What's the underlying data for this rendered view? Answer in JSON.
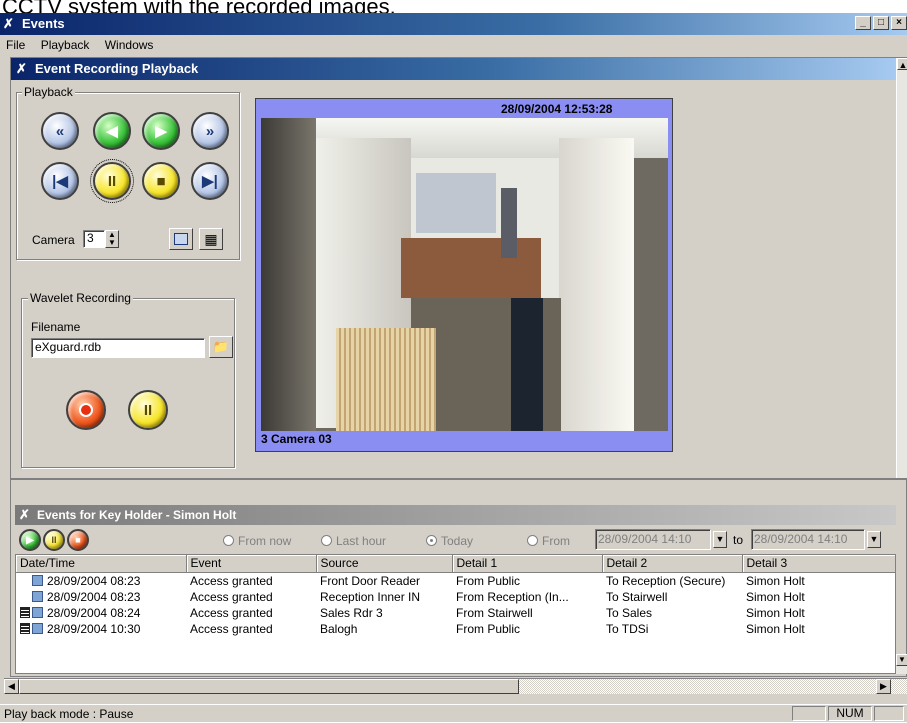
{
  "caption": "CCTV system with the recorded images.",
  "window": {
    "title": "Events",
    "btn_min": "_",
    "btn_max": "□",
    "btn_close": "×"
  },
  "menu": [
    "File",
    "Playback",
    "Windows"
  ],
  "playback_window": {
    "title": "Event Recording Playback"
  },
  "playback": {
    "group_label": "Playback",
    "camera_label": "Camera",
    "camera_value": "3",
    "buttons": {
      "rewind_fast": "«",
      "prev": "◀",
      "play": "▶",
      "forward_fast": "»",
      "first": "|◀",
      "pause": "II",
      "stop": "■",
      "last": "▶|"
    }
  },
  "wavelet": {
    "group_label": "Wavelet Recording",
    "filename_label": "Filename",
    "filename_value": "eXguard.rdb"
  },
  "video": {
    "timestamp": "28/09/2004 12:53:28",
    "camera_caption": "3 Camera 03"
  },
  "events": {
    "title": "Events for Key Holder - Simon Holt",
    "radios": [
      {
        "label": "From now",
        "selected": false
      },
      {
        "label": "Last hour",
        "selected": false
      },
      {
        "label": "Today",
        "selected": true
      },
      {
        "label": "From",
        "selected": false
      }
    ],
    "from_date": "28/09/2004 14:10",
    "to_label": "to",
    "to_date": "28/09/2004 14:10",
    "columns": [
      "Date/Time",
      "Event",
      "Source",
      "Detail 1",
      "Detail 2",
      "Detail 3"
    ],
    "rows": [
      {
        "film": false,
        "datetime": "28/09/2004 08:23",
        "event": "Access granted",
        "source": "Front Door Reader",
        "detail1": "From Public",
        "detail2": "To Reception (Secure)",
        "detail3": "Simon Holt"
      },
      {
        "film": false,
        "datetime": "28/09/2004 08:23",
        "event": "Access granted",
        "source": "Reception Inner IN",
        "detail1": "From Reception (In...",
        "detail2": "To Stairwell",
        "detail3": "Simon Holt"
      },
      {
        "film": true,
        "datetime": "28/09/2004 08:24",
        "event": "Access granted",
        "source": "Sales  Rdr 3",
        "detail1": "From Stairwell",
        "detail2": "To Sales",
        "detail3": "Simon Holt"
      },
      {
        "film": true,
        "datetime": "28/09/2004 10:30",
        "event": "Access granted",
        "source": "Balogh",
        "detail1": "From Public",
        "detail2": "To TDSi",
        "detail3": "Simon Holt"
      }
    ]
  },
  "status": {
    "text": "Play back mode : Pause",
    "num": "NUM"
  }
}
